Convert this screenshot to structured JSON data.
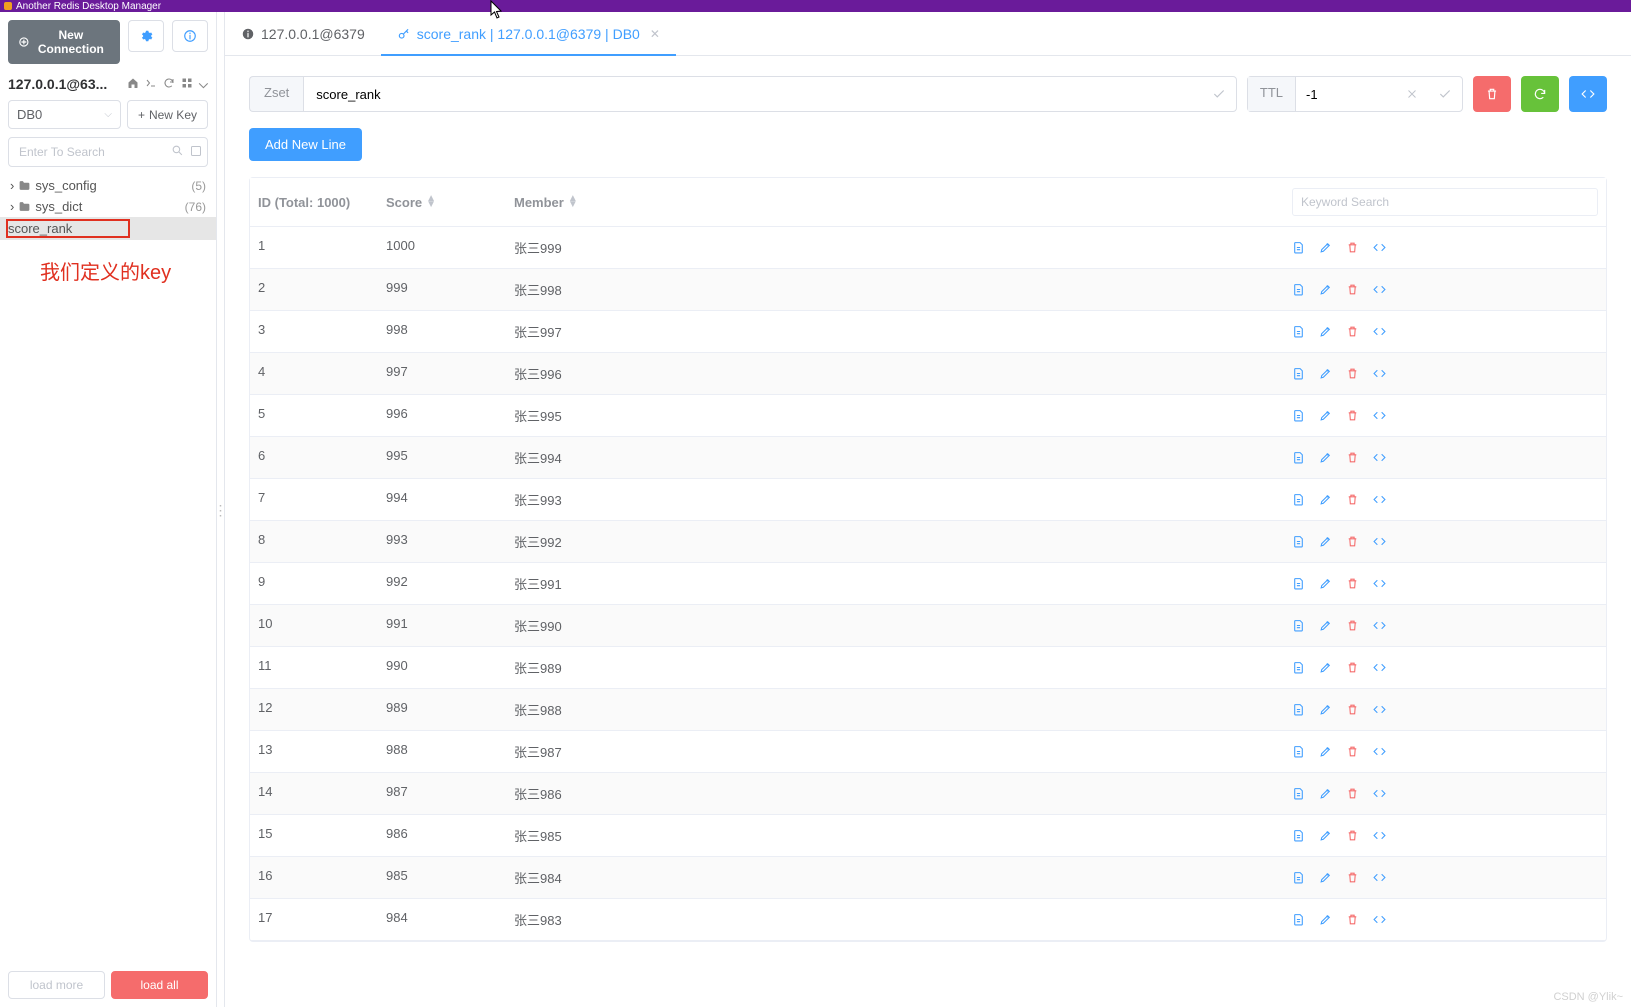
{
  "titlebar": {
    "title": "Another Redis Desktop Manager"
  },
  "sidebar": {
    "new_connection": "New Connection",
    "connection_label": "127.0.0.1@63...",
    "db_select": "DB0",
    "new_key": "New Key",
    "search_placeholder": "Enter To Search",
    "tree": [
      {
        "name": "sys_config",
        "count": "(5)"
      },
      {
        "name": "sys_dict",
        "count": "(76)"
      }
    ],
    "selected_key": "score_rank",
    "annotation": "我们定义的key",
    "load_more": "load more",
    "load_all": "load all"
  },
  "tabs": [
    {
      "label": "127.0.0.1@6379",
      "active": false
    },
    {
      "label": "score_rank | 127.0.0.1@6379 | DB0",
      "active": true
    }
  ],
  "key_editor": {
    "type": "Zset",
    "key_name": "score_rank",
    "ttl_label": "TTL",
    "ttl_value": "-1",
    "add_line": "Add New Line"
  },
  "table": {
    "header_id": "ID (Total: 1000)",
    "header_score": "Score",
    "header_member": "Member",
    "search_placeholder": "Keyword Search",
    "rows": [
      {
        "id": "1",
        "score": "1000",
        "member": "张三999"
      },
      {
        "id": "2",
        "score": "999",
        "member": "张三998"
      },
      {
        "id": "3",
        "score": "998",
        "member": "张三997"
      },
      {
        "id": "4",
        "score": "997",
        "member": "张三996"
      },
      {
        "id": "5",
        "score": "996",
        "member": "张三995"
      },
      {
        "id": "6",
        "score": "995",
        "member": "张三994"
      },
      {
        "id": "7",
        "score": "994",
        "member": "张三993"
      },
      {
        "id": "8",
        "score": "993",
        "member": "张三992"
      },
      {
        "id": "9",
        "score": "992",
        "member": "张三991"
      },
      {
        "id": "10",
        "score": "991",
        "member": "张三990"
      },
      {
        "id": "11",
        "score": "990",
        "member": "张三989"
      },
      {
        "id": "12",
        "score": "989",
        "member": "张三988"
      },
      {
        "id": "13",
        "score": "988",
        "member": "张三987"
      },
      {
        "id": "14",
        "score": "987",
        "member": "张三986"
      },
      {
        "id": "15",
        "score": "986",
        "member": "张三985"
      },
      {
        "id": "16",
        "score": "985",
        "member": "张三984"
      },
      {
        "id": "17",
        "score": "984",
        "member": "张三983"
      }
    ]
  },
  "watermark": "CSDN @Ylik~"
}
